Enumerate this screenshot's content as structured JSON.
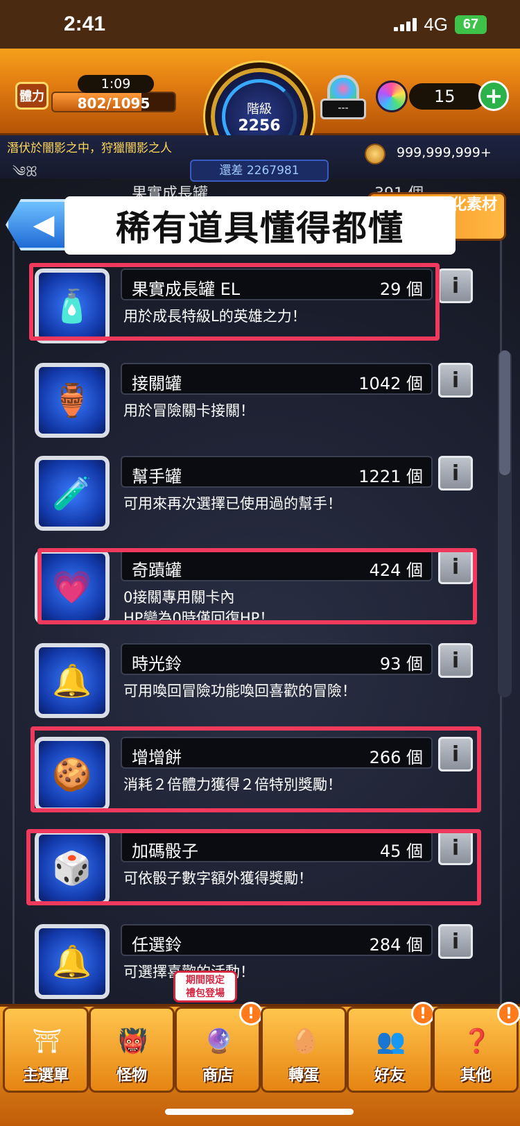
{
  "status_bar": {
    "time": "2:41",
    "network": "4G",
    "battery": "67"
  },
  "header": {
    "stamina_label": "體力",
    "stamina_timer": "1:09",
    "stamina_value": "802/1095",
    "stamina_fraction": 0.73,
    "rank_label": "階級",
    "rank_value": "2256",
    "lock_text": "---",
    "orb_count": "15",
    "plus_label": "+",
    "title_text": "潛伏於闇影之中，狩獵闇影之人",
    "coin_value": "999,999,999+",
    "exp_remaining": "還差 2267981"
  },
  "overlay_caption": "稀有道具懂得都懂",
  "partial_row": {
    "name": "果實成長罐",
    "count": "391 個"
  },
  "evolve_tag": "進化素材",
  "items": [
    {
      "name": "果實成長罐 EL",
      "count": "29 個",
      "desc": "用於成長特級L的英雄之力！",
      "icon": "potion-bottle-icon",
      "glyph": "🧴"
    },
    {
      "name": "接關罐",
      "count": "1042 個",
      "desc": "用於冒險關卡接關！",
      "icon": "continue-jar-icon",
      "glyph": "🏺"
    },
    {
      "name": "幫手罐",
      "count": "1221 個",
      "desc": "可用來再次選擇已使用過的幫手！",
      "icon": "helper-jar-icon",
      "glyph": "🧪"
    },
    {
      "name": "奇蹟罐",
      "count": "424 個",
      "desc": "0接關專用關卡內\nHP變為0時僅回復HP！",
      "icon": "miracle-heart-jar-icon",
      "glyph": "💗"
    },
    {
      "name": "時光鈴",
      "count": "93 個",
      "desc": "可用喚回冒險功能喚回喜歡的冒險！",
      "icon": "time-bell-icon",
      "glyph": "🔔"
    },
    {
      "name": "增增餅",
      "count": "266 個",
      "desc": "消耗２倍體力獲得２倍特別獎勵！",
      "icon": "x2-cookie-icon",
      "glyph": "🍪"
    },
    {
      "name": "加碼骰子",
      "count": "45 個",
      "desc": "可依骰子數字額外獲得獎勵！",
      "icon": "bonus-dice-icon",
      "glyph": "🎲"
    },
    {
      "name": "任選鈴",
      "count": "284 個",
      "desc": "可選擇喜歡的活動！",
      "icon": "choice-bell-icon",
      "glyph": "🔔"
    }
  ],
  "nav": {
    "tabs": [
      {
        "label": "主選單",
        "icon": "home-gate-icon",
        "glyph": "⛩"
      },
      {
        "label": "怪物",
        "icon": "monster-icon",
        "glyph": "👹"
      },
      {
        "label": "商店",
        "icon": "rainbow-orb-shop-icon",
        "glyph": "🔮"
      },
      {
        "label": "轉蛋",
        "icon": "gacha-egg-icon",
        "glyph": "🥚"
      },
      {
        "label": "好友",
        "icon": "friends-icon",
        "glyph": "👥"
      },
      {
        "label": "其他",
        "icon": "other-icon",
        "glyph": "❓"
      }
    ],
    "shop_promo": "期間限定\n禮包登場",
    "badge": "!"
  }
}
